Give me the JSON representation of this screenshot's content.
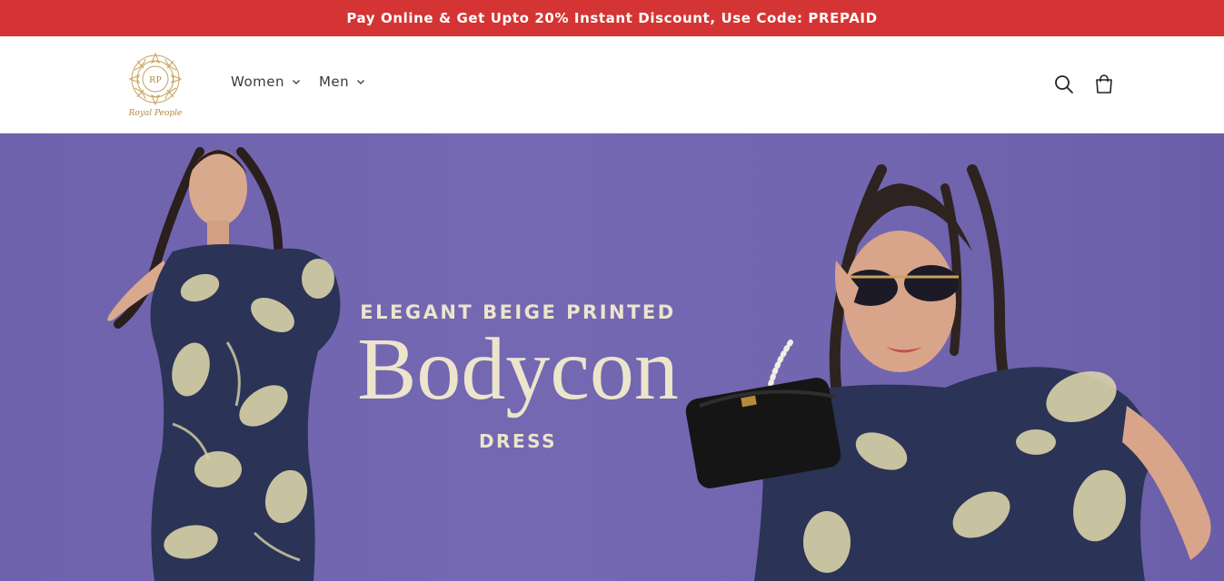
{
  "announcement": {
    "text": "Pay Online & Get Upto 20% Instant Discount, Use Code: PREPAID",
    "bg_color": "#d43534"
  },
  "header": {
    "logo": {
      "monogram": "RP",
      "name": "Royal People",
      "color": "#b38b3f"
    },
    "nav": [
      {
        "label": "Women",
        "icon": "chevron-down-icon"
      },
      {
        "label": "Men",
        "icon": "chevron-down-icon"
      }
    ],
    "icons": {
      "search": "search-icon",
      "cart": "cart-icon"
    }
  },
  "hero": {
    "line1": "ELEGANT BEIGE PRINTED",
    "line2": "Bodycon",
    "line3": "DRESS",
    "bg_color": "#7268b0",
    "text_color": "#ece5cc"
  }
}
